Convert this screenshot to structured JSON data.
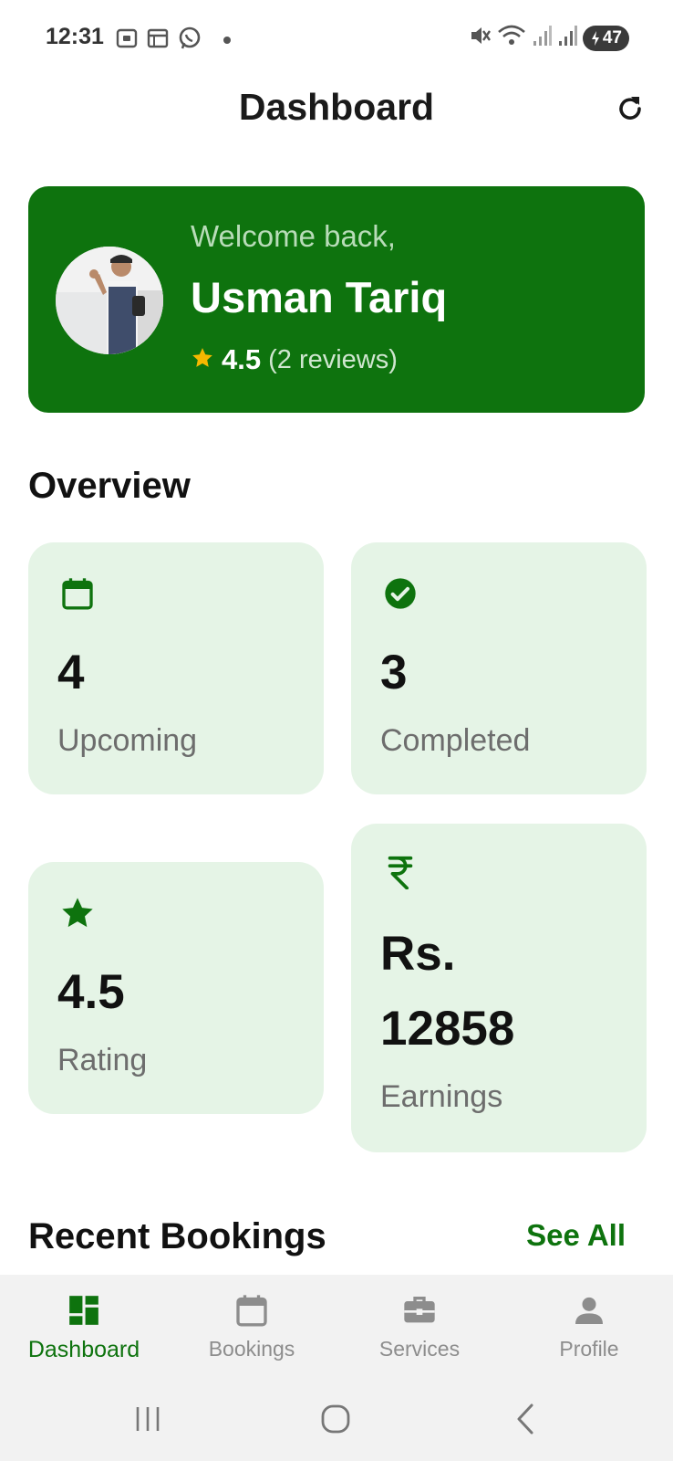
{
  "status_bar": {
    "time": "12:31",
    "battery": "47",
    "icons": [
      "screenshot-icon",
      "calendar-notification-icon",
      "whatsapp-icon",
      "dot-icon",
      "mute-icon",
      "wifi-icon",
      "signal-icon",
      "signal-icon",
      "battery-icon"
    ]
  },
  "header": {
    "title": "Dashboard",
    "refresh_icon": "refresh-icon"
  },
  "welcome": {
    "greeting": "Welcome back,",
    "name": "Usman Tariq",
    "rating": "4.5",
    "reviews": "(2 reviews)"
  },
  "overview": {
    "title": "Overview",
    "cards": [
      {
        "icon": "calendar-icon",
        "value": "4",
        "label": "Upcoming"
      },
      {
        "icon": "check-circle-icon",
        "value": "3",
        "label": "Completed"
      },
      {
        "icon": "star-icon",
        "value": "4.5",
        "label": "Rating"
      },
      {
        "icon": "rupee-icon",
        "value_line1": "Rs.",
        "value_line2": "12858",
        "label": "Earnings"
      }
    ]
  },
  "recent": {
    "title": "Recent Bookings",
    "see_all": "See All"
  },
  "bottom_nav": {
    "items": [
      {
        "label": "Dashboard",
        "icon": "dashboard-icon",
        "active": true
      },
      {
        "label": "Bookings",
        "icon": "calendar-icon",
        "active": false
      },
      {
        "label": "Services",
        "icon": "toolbox-icon",
        "active": false
      },
      {
        "label": "Profile",
        "icon": "person-icon",
        "active": false
      }
    ]
  },
  "colors": {
    "brand_green": "#0e730e",
    "card_bg": "#e5f4e6",
    "star_yellow": "#f5b800"
  }
}
